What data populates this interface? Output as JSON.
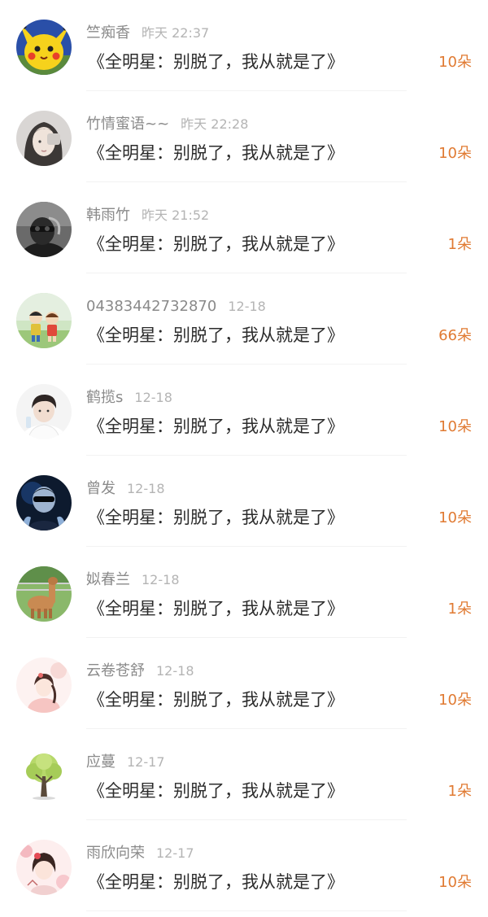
{
  "gift_list": {
    "items": [
      {
        "user": "竺痴香",
        "time": "昨天 22:37",
        "gift": "《全明星：别脱了，我从就是了》",
        "count": "10朵",
        "avatar_icon": "pikachu-avatar-icon"
      },
      {
        "user": "竹情蜜语~~",
        "time": "昨天 22:28",
        "gift": "《全明星：别脱了，我从就是了》",
        "count": "10朵",
        "avatar_icon": "girl-portrait-avatar-icon"
      },
      {
        "user": "韩雨竹",
        "time": "昨天 21:52",
        "gift": "《全明星：别脱了，我从就是了》",
        "count": "1朵",
        "avatar_icon": "masked-man-avatar-icon"
      },
      {
        "user": "04383442732870",
        "time": "12-18",
        "gift": "《全明星：别脱了，我从就是了》",
        "count": "66朵",
        "avatar_icon": "cartoon-kids-avatar-icon"
      },
      {
        "user": "鹤揽s",
        "time": "12-18",
        "gift": "《全明星：别脱了，我从就是了》",
        "count": "10朵",
        "avatar_icon": "young-man-avatar-icon"
      },
      {
        "user": "曾发",
        "time": "12-18",
        "gift": "《全明星：别脱了，我从就是了》",
        "count": "10朵",
        "avatar_icon": "sunglasses-man-avatar-icon"
      },
      {
        "user": "姒春兰",
        "time": "12-18",
        "gift": "《全明星：别脱了，我从就是了》",
        "count": "1朵",
        "avatar_icon": "alpaca-avatar-icon"
      },
      {
        "user": "云卷苍舒",
        "time": "12-18",
        "gift": "《全明星：别脱了，我从就是了》",
        "count": "10朵",
        "avatar_icon": "illustrated-girl-avatar-icon"
      },
      {
        "user": "应蔓",
        "time": "12-17",
        "gift": "《全明星：别脱了，我从就是了》",
        "count": "1朵",
        "avatar_icon": "tree-avatar-icon"
      },
      {
        "user": "雨欣向荣",
        "time": "12-17",
        "gift": "《全明星：别脱了，我从就是了》",
        "count": "10朵",
        "avatar_icon": "floral-girl-avatar-icon"
      }
    ]
  },
  "colors": {
    "count": "#e07a32",
    "username": "#8a8a8a",
    "time": "#b4b4b4",
    "gift_title": "#2b2b2b"
  }
}
